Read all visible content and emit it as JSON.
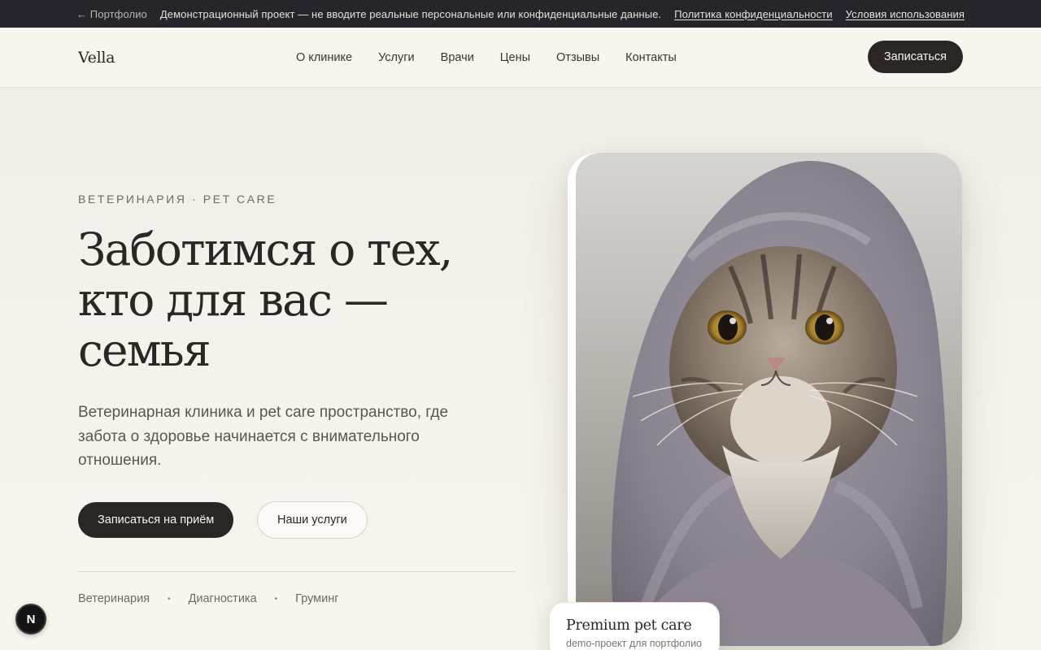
{
  "demo_bar": {
    "back_label": "← Портфолио",
    "notice": "Демонстрационный проект — не вводите реальные персональные или конфиденциальные данные.",
    "privacy_link": "Политика конфиденциальности",
    "terms_link": "Условия использования"
  },
  "header": {
    "logo": "Vella",
    "nav": [
      "О клинике",
      "Услуги",
      "Врачи",
      "Цены",
      "Отзывы",
      "Контакты"
    ],
    "cta": "Записаться"
  },
  "hero": {
    "eyebrow": "ВЕТЕРИНАРИЯ · PET CARE",
    "headline_lines": [
      "Заботимся о тех,",
      "кто для вас —",
      "семья"
    ],
    "subtitle": "Ветеринарная клиника и pet care пространство, где забота о здоровье начинается с внимательного отношения.",
    "primary_button": "Записаться на приём",
    "secondary_button": "Наши услуги",
    "tags": [
      "Ветеринария",
      "Диагностика",
      "Груминг"
    ],
    "tag_separator": "•"
  },
  "photo": {
    "icon": "cat-in-towel-photo"
  },
  "badge": {
    "title": "Premium pet care",
    "subtitle": "demo-проект для портфолио"
  },
  "fab": {
    "label": "N"
  },
  "colors": {
    "dark": "#2b2624",
    "background": "#f8f5ef",
    "demo_bar": "#26252b",
    "muted_text": "#6f6962"
  }
}
